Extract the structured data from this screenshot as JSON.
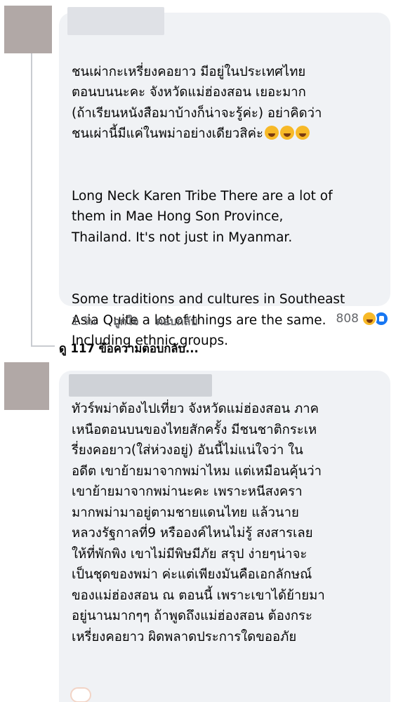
{
  "comments": [
    {
      "author_hidden": true,
      "paragraphs": [
        "ชนเผ่ากะเหรี่ยงคอยาว มีอยู่ในประเทศไทย\nตอนบนนะคะ จังหวัดแม่ฮ่องสอน เยอะมาก\n(ถ้าเรียนหนังสือมาบ้างก็น่าจะรู้ค่ะ) อย่าคิดว่า\nชนเผ่านี้มีแค่ในพม่าอย่างเดียวสิค่ะ",
        "Long Neck Karen Tribe  There are a lot of\nthem in Mae Hong Son Province,\nThailand. It's not just in Myanmar.",
        "Some traditions and cultures in Southeast\nAsia  Quite a lot of things are the same.\nIncluding ethnic groups."
      ],
      "emoji": [
        "rofl-emoji",
        "rofl-emoji",
        "rofl-emoji"
      ],
      "actions": {
        "time": "1 วัน",
        "like": "ถูกใจ",
        "reply": "ตอบกลับ"
      },
      "reactions": {
        "count": "808",
        "icons": [
          "haha-icon",
          "like-icon"
        ]
      },
      "view_replies": "ดู 117 ข้อความตอบกลับ..."
    },
    {
      "author_hidden": true,
      "text": "ทัวร์พม่าต้องไปเที่ยว จังหวัดแม่ฮ่องสอน ภาค\nเหนือตอนบนของไทยสักครั้ง  มีชนชาติกระเห\nรี่ยงคอยาว(ใส่ห่วงอยู่)  อันนี้ไม่แน่ใจว่า ใน\nอดีต เขาย้ายมาจากพม่าไหม แต่เหมือนคุ้นว่า\nเขาย้ายมาจากพม่านะคะ  เพราะหนีสงครา\nมากพม่ามาอยู่ตามชายแดนไทย  แล้วนาย\nหลวงรัฐกาลที่9  หรือองค์ไหนไม่รู้ สงสารเลย\nให้ที่พักพิง เขาไม่มีพิษมีภัย  สรุป ง่ายๆน่าจะ\nเป็นชุดของพม่า ค่ะแต่เพียงมันคือเอกลักษณ์\nของแม่ฮ่องสอน ณ ตอนนี้ เพราะเขาได้ย้ายมา\nอยู่นานมากๆๆ ถ้าพูดถึงแม่ฮ่องสอน ต้องกระ\nเหรี่ยงคอยาว ผิดพลาดประการใดขออภัย"
    }
  ]
}
